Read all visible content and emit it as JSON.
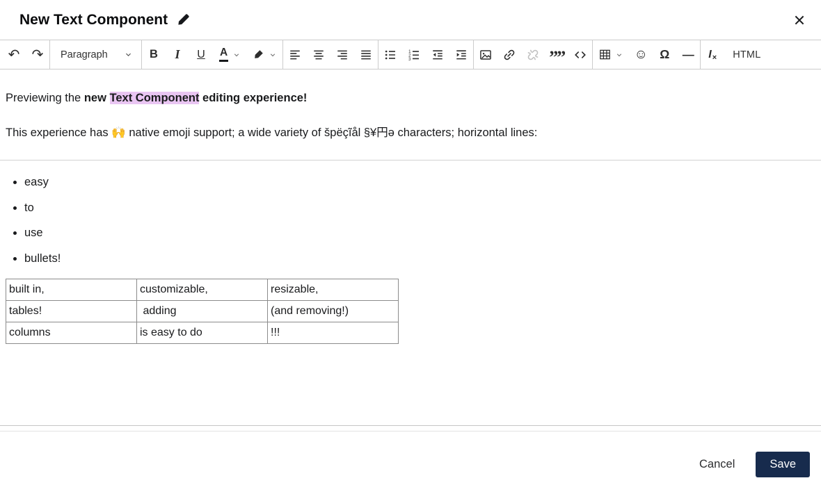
{
  "header": {
    "title": "New Text Component"
  },
  "toolbar": {
    "undo_glyph": "↶",
    "redo_glyph": "↷",
    "paragraph_label": "Paragraph",
    "bold_glyph": "B",
    "italic_glyph": "I",
    "underline_glyph": "U",
    "text_color_glyph": "A",
    "quote_glyph": "””",
    "smiley_glyph": "☺",
    "omega_glyph": "Ω",
    "hline_glyph": "—",
    "clear_format_main": "I",
    "clear_format_sub": "×",
    "html_label": "HTML"
  },
  "content": {
    "paragraph1": {
      "normal": "Previewing the ",
      "bold_prefix": "new ",
      "highlighted": "Text Component",
      "bold_suffix": " editing experience!"
    },
    "paragraph2": "This experience has 🙌 native emoji support; a wide variety of špëçĩål §¥円ǝ characters; horizontal lines:",
    "bullets": [
      "easy",
      "to",
      "use",
      "bullets!"
    ],
    "table_rows": [
      [
        "built in,",
        "customizable,",
        "resizable,"
      ],
      [
        "tables!",
        " adding",
        "(and removing!)"
      ],
      [
        "columns",
        "is easy to do",
        "!!!"
      ]
    ]
  },
  "footer": {
    "cancel_label": "Cancel",
    "save_label": "Save"
  },
  "colors": {
    "highlight": "#e9c5f2",
    "save_button": "#172b4d",
    "toolbar_icon": "#2d2d2d",
    "border": "#cbcbcb",
    "disabled_icon": "#c1c1c1"
  }
}
